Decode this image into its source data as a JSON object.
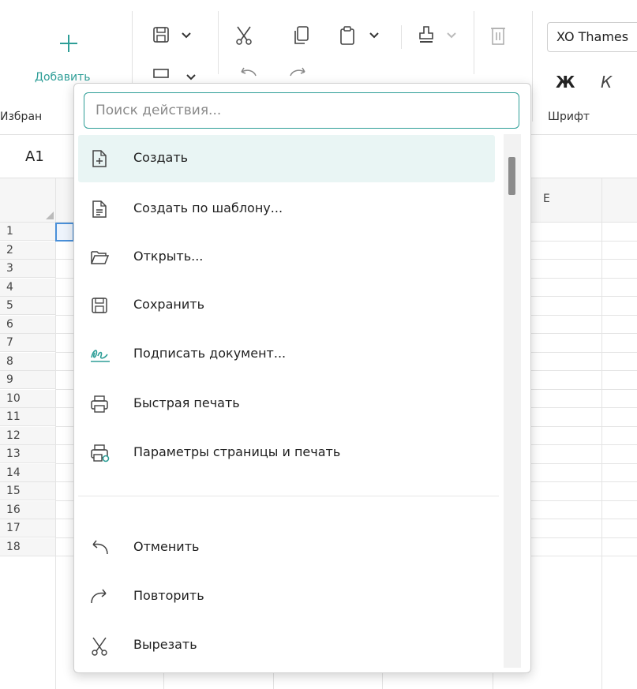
{
  "ribbon": {
    "add_label": "Добавить",
    "favorites_label": "Избран",
    "font_name": "XO Thames",
    "font_group_label": "Шрифт",
    "bold_glyph": "Ж",
    "italic_glyph": "К"
  },
  "name_box": "A1",
  "columns": [
    "E"
  ],
  "rows": [
    "1",
    "2",
    "3",
    "4",
    "5",
    "6",
    "7",
    "8",
    "9",
    "10",
    "11",
    "12",
    "13",
    "14",
    "15",
    "16",
    "17",
    "18"
  ],
  "popup": {
    "search_placeholder": "Поиск действия...",
    "items": [
      {
        "label": "Создать",
        "icon": "new-document-icon"
      },
      {
        "label": "Создать по шаблону...",
        "icon": "template-document-icon"
      },
      {
        "label": "Открыть...",
        "icon": "folder-open-icon"
      },
      {
        "label": "Сохранить",
        "icon": "save-icon"
      },
      {
        "label": "Подписать документ...",
        "icon": "signature-icon"
      },
      {
        "label": "Быстрая печать",
        "icon": "printer-icon"
      },
      {
        "label": "Параметры страницы и печать",
        "icon": "print-settings-icon"
      },
      {
        "label": "Отменить",
        "icon": "undo-icon"
      },
      {
        "label": "Повторить",
        "icon": "redo-icon"
      },
      {
        "label": "Вырезать",
        "icon": "cut-icon"
      }
    ]
  },
  "colors": {
    "accent": "#2e9e97",
    "active_item_bg": "#e9f5f4",
    "signature_icon": "#2e9e97"
  }
}
